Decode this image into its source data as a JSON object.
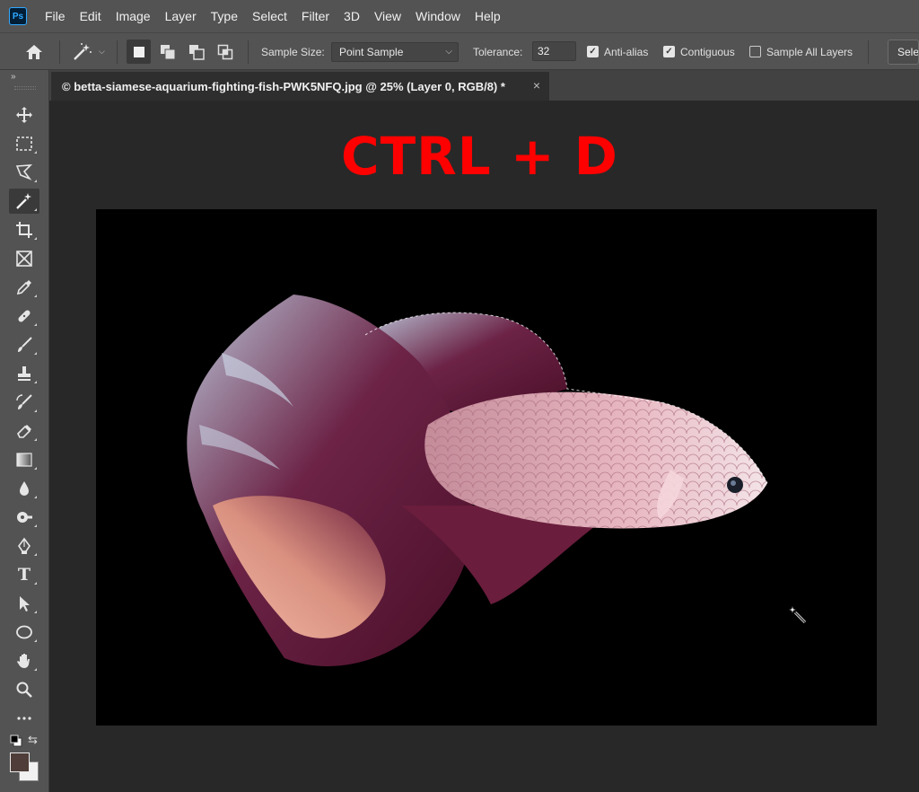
{
  "app": {
    "logo": "Ps"
  },
  "menu": [
    "File",
    "Edit",
    "Image",
    "Layer",
    "Type",
    "Select",
    "Filter",
    "3D",
    "View",
    "Window",
    "Help"
  ],
  "options": {
    "sample_size_label": "Sample Size:",
    "sample_size_value": "Point Sample",
    "tolerance_label": "Tolerance:",
    "tolerance_value": "32",
    "anti_alias_label": "Anti-alias",
    "anti_alias_checked": true,
    "contiguous_label": "Contiguous",
    "contiguous_checked": true,
    "sample_all_layers_label": "Sample All Layers",
    "sample_all_layers_checked": false,
    "select_subject_label": "Select Subject"
  },
  "document": {
    "tab_title": "© betta-siamese-aquarium-fighting-fish-PWK5NFQ.jpg @ 25% (Layer 0, RGB/8) *",
    "tab_close": "×"
  },
  "overlay": {
    "shortcut": "CTRL + D"
  },
  "toolbar": {
    "collapse": "»",
    "type_tool_glyph": "T",
    "active_tool": "magic-wand-tool",
    "foreground_color": "#4e3d38",
    "background_color": "#f1f1f1"
  },
  "colors": {
    "menubar": "#535353",
    "workspace": "#282828",
    "shortcut_text": "#ff0000"
  }
}
